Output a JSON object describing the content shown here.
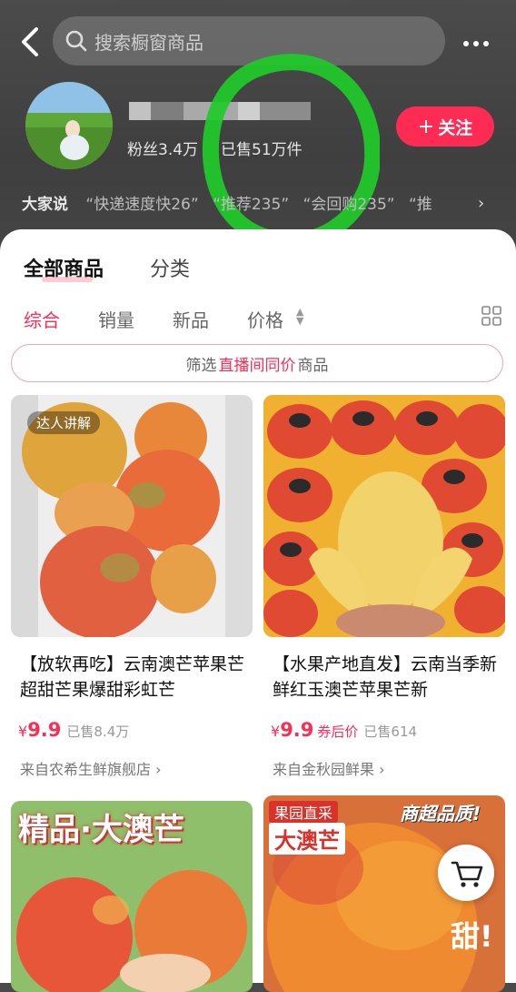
{
  "header": {
    "search_placeholder": "搜索橱窗商品",
    "fans": "粉丝3.4万",
    "sold": "已售51万件",
    "follow_label": "关注",
    "tags_lead": "大家说",
    "tags": [
      "“快递速度快26”",
      "“推荐235”",
      "“会回购235”",
      "“推"
    ]
  },
  "tabs": {
    "all": "全部商品",
    "category": "分类"
  },
  "sort": {
    "comprehensive": "综合",
    "sales": "销量",
    "new": "新品",
    "price": "价格"
  },
  "filter": {
    "prefix": "筛选",
    "highlight": "直播间同价",
    "suffix": "商品"
  },
  "products": [
    {
      "badge": "达人讲解",
      "title": "【放软再吃】云南澳芒苹果芒超甜芒果爆甜彩虹芒",
      "yen": "¥",
      "price": "9.9",
      "coupon": "",
      "sold": "已售8.4万",
      "shop": "来自农希生鲜旗舰店 ›"
    },
    {
      "badge": "",
      "title": "【水果产地直发】云南当季新鲜红玉澳芒苹果芒新",
      "yen": "¥",
      "price": "9.9",
      "coupon": "券后价",
      "sold": "已售614",
      "shop": "来自金秋园鲜果 ›"
    },
    {
      "banner": "精品·大澳芒"
    },
    {
      "banner_top": "果园直采",
      "banner_main": "大澳芒",
      "banner_right": "商超品质!",
      "side_text": "甜!"
    }
  ],
  "colors": {
    "accent": "#fe2c55",
    "header_bg": "#444444"
  }
}
